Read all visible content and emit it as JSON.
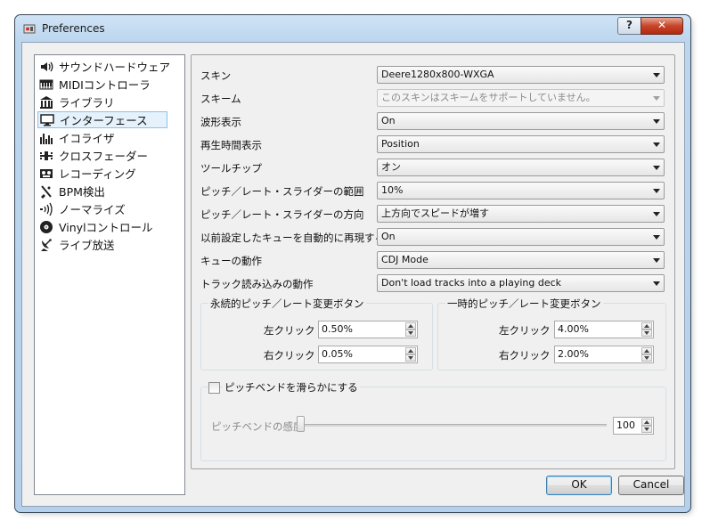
{
  "window": {
    "title": "Preferences",
    "help_label": "?",
    "close_label": "✕"
  },
  "sidebar": {
    "items": [
      {
        "label": "サウンドハードウェア",
        "icon": "speaker-icon"
      },
      {
        "label": "MIDIコントローラ",
        "icon": "midi-keyboard-icon"
      },
      {
        "label": "ライブラリ",
        "icon": "library-icon"
      },
      {
        "label": "インターフェース",
        "icon": "monitor-icon",
        "selected": true
      },
      {
        "label": "イコライザ",
        "icon": "equalizer-icon"
      },
      {
        "label": "クロスフェーダー",
        "icon": "crossfader-icon"
      },
      {
        "label": "レコーディング",
        "icon": "tape-icon"
      },
      {
        "label": "BPM検出",
        "icon": "metronome-icon"
      },
      {
        "label": "ノーマライズ",
        "icon": "normalize-icon"
      },
      {
        "label": "Vinylコントロール",
        "icon": "vinyl-icon"
      },
      {
        "label": "ライブ放送",
        "icon": "broadcast-dish-icon"
      }
    ]
  },
  "settings": [
    {
      "label": "スキン",
      "value": "Deere1280x800-WXGA"
    },
    {
      "label": "スキーム",
      "value": "このスキンはスキームをサポートしていません。",
      "disabled": true
    },
    {
      "label": "波形表示",
      "value": "On"
    },
    {
      "label": "再生時間表示",
      "value": "Position"
    },
    {
      "label": "ツールチップ",
      "value": "オン"
    },
    {
      "label": "ピッチ／レート・スライダーの範囲",
      "value": "10%"
    },
    {
      "label": "ピッチ／レート・スライダーの方向",
      "value": "上方向でスピードが増す"
    },
    {
      "label": "以前設定したキューを自動的に再現する",
      "value": "On"
    },
    {
      "label": "キューの動作",
      "value": "CDJ Mode"
    },
    {
      "label": "トラック読み込みの動作",
      "value": "Don't load tracks into a playing deck"
    }
  ],
  "permanent_group": {
    "title": "永続的ピッチ／レート変更ボタン",
    "left_label": "左クリック",
    "left_value": "0.50%",
    "right_label": "右クリック",
    "right_value": "0.05%"
  },
  "temporary_group": {
    "title": "一時的ピッチ／レート変更ボタン",
    "left_label": "左クリック",
    "left_value": "4.00%",
    "right_label": "右クリック",
    "right_value": "2.00%"
  },
  "pitchbend": {
    "checkbox_label": "ピッチベンドを滑らかにする",
    "checked": false,
    "sensitivity_label": "ピッチベンドの感度",
    "sensitivity_value": "100"
  },
  "footer": {
    "ok_label": "OK",
    "cancel_label": "Cancel"
  },
  "colors": {
    "accent": "#3c7fb1",
    "selection_bg": "#e5f2fb",
    "close_red": "#c7462b"
  }
}
